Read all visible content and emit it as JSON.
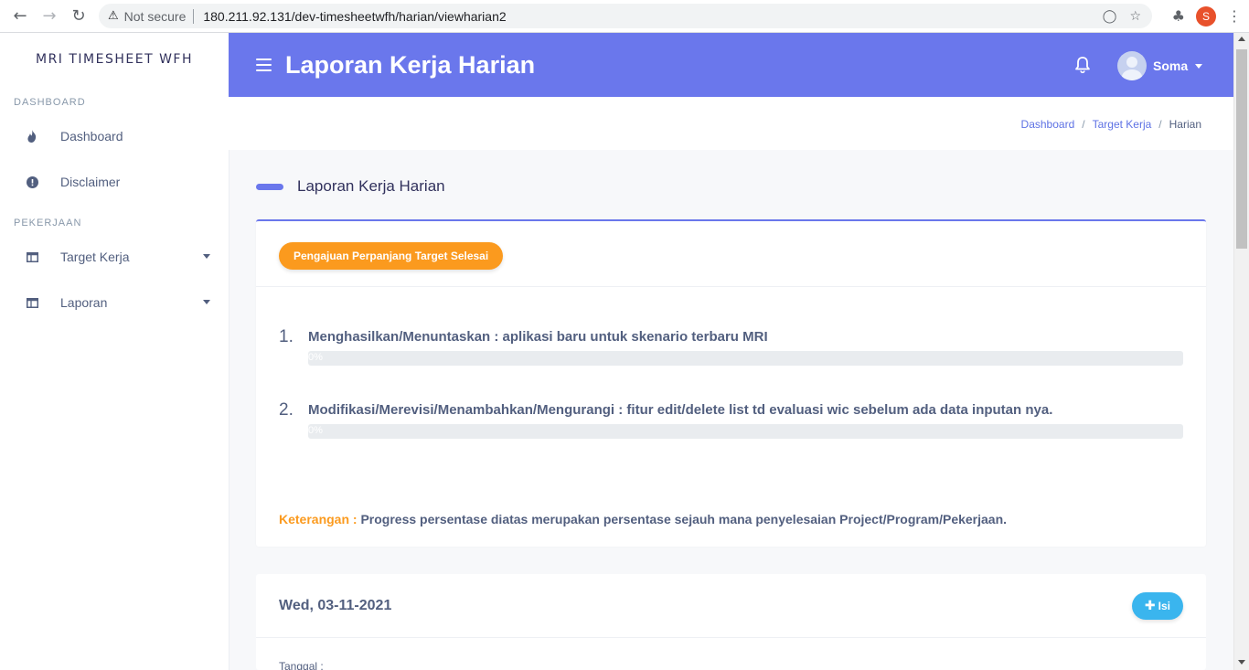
{
  "browser": {
    "security_label": "Not secure",
    "url": "180.211.92.131/dev-timesheetwfh/harian/viewharian2",
    "profile_initial": "S"
  },
  "sidebar": {
    "brand": "MRI TIMESHEET WFH",
    "sections": [
      {
        "heading": "DASHBOARD",
        "items": [
          {
            "label": "Dashboard",
            "icon": "flame-icon"
          },
          {
            "label": "Disclaimer",
            "icon": "info-circle-icon"
          }
        ]
      },
      {
        "heading": "PEKERJAAN",
        "items": [
          {
            "label": "Target Kerja",
            "icon": "table-icon"
          },
          {
            "label": "Laporan",
            "icon": "table-icon"
          }
        ]
      }
    ]
  },
  "header": {
    "title": "Laporan Kerja Harian",
    "user_name": "Soma"
  },
  "breadcrumb": [
    "Dashboard",
    "Target Kerja",
    "Harian"
  ],
  "main": {
    "section_title": "Laporan Kerja Harian",
    "extend_button": "Pengajuan Perpanjang Target Selesai",
    "tasks": [
      {
        "number": "1.",
        "description": "Menghasilkan/Menuntaskan : aplikasi baru untuk skenario terbaru MRI",
        "progress": 0,
        "progress_label": "0%"
      },
      {
        "number": "2.",
        "description": "Modifikasi/Merevisi/Menambahkan/Mengurangi : fitur edit/delete list td evaluasi wic sebelum ada data inputan nya.",
        "progress": 0,
        "progress_label": "0%"
      }
    ],
    "note_key": "Keterangan :",
    "note_text": "Progress persentase diatas merupakan persentase sejauh mana penyelesaian Project/Program/Pekerjaan."
  },
  "day_card": {
    "date": "Wed, 03-11-2021",
    "add_button": "Isi",
    "field_label": "Tanggal :"
  },
  "colors": {
    "accent": "#6a77ec",
    "orange": "#fb9a1e",
    "cyan": "#3ab5ee"
  }
}
